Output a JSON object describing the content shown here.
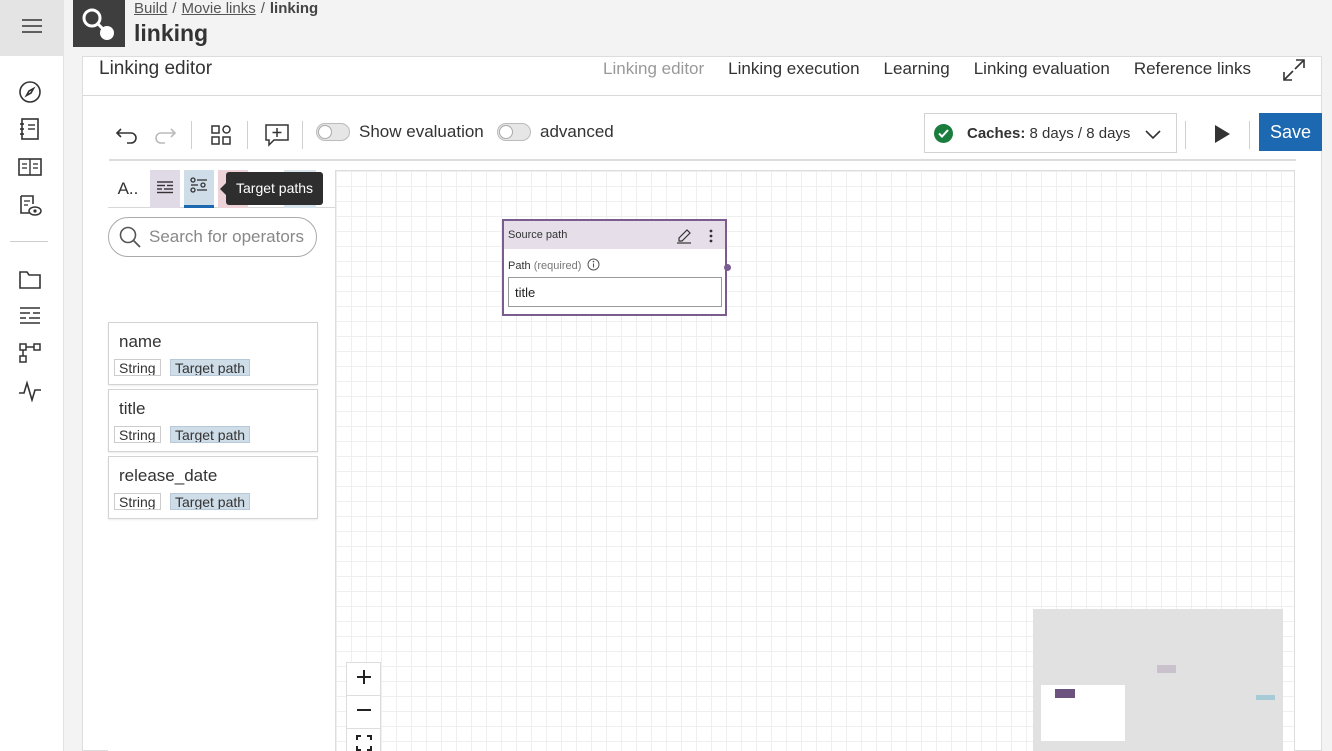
{
  "breadcrumb": {
    "items": [
      "Build",
      "Movie links"
    ],
    "separator": "/",
    "current": "linking"
  },
  "page": {
    "title": "linking"
  },
  "panel": {
    "title": "Linking editor",
    "tabs": [
      "Linking editor",
      "Linking execution",
      "Learning",
      "Linking evaluation",
      "Reference links"
    ],
    "active_tab": "Linking editor"
  },
  "toolbar": {
    "show_evaluation_label": "Show evaluation",
    "advanced_label": "advanced",
    "caches_label": "Caches:",
    "caches_value": "8 days / 8 days",
    "save_label": "Save",
    "status_color": "#1b7d3d",
    "save_color": "#1d69b1"
  },
  "sidebar": {
    "all_tab_label": "A..",
    "tooltip": "Target paths",
    "search_placeholder": "Search for operators",
    "operators": [
      {
        "name": "name",
        "type": "String",
        "kind": "Target path"
      },
      {
        "name": "title",
        "type": "String",
        "kind": "Target path"
      },
      {
        "name": "release_date",
        "type": "String",
        "kind": "Target path"
      }
    ]
  },
  "node": {
    "title": "Source path",
    "param_label": "Path",
    "param_required": "(required)",
    "value": "title",
    "accent_color": "#7b5c8f"
  },
  "icons": {
    "rail": [
      "menu-icon",
      "explore-icon",
      "notebook-icon",
      "list-icon",
      "dataset-view-icon",
      "folder-icon",
      "linking-icon",
      "workflow-icon",
      "activity-icon"
    ]
  }
}
